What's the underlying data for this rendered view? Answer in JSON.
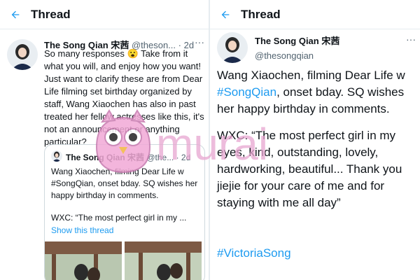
{
  "colors": {
    "accent": "#1d9bf0",
    "text": "#0f1419",
    "muted": "#536471",
    "border": "#cfd9de"
  },
  "left": {
    "header": {
      "title": "Thread",
      "back_icon": "arrow-left-icon"
    },
    "tweet": {
      "name": "The Song Qian 宋茜",
      "handle": "@theson...",
      "time": "· 2d",
      "text": "So many responses 😮 Take from it what you will, and enjoy how you want! Just want to clarify these are from Dear Life filming set birthday organized by staff, Wang Xiaochen has also in past treated her fellow actresses like this, it's not an announcement or anything particular?"
    },
    "quote": {
      "name": "The Song Qian 宋茜",
      "handle": "@the...",
      "time": "· 2d",
      "text": "Wang Xiaochen, filming Dear Life w #SongQian, onset bday. SQ wishes her happy birthday in comments.",
      "wxc": "WXC: “The most perfect girl in my ...",
      "show_thread": "Show this thread"
    }
  },
  "right": {
    "header": {
      "title": "Thread",
      "back_icon": "arrow-left-icon"
    },
    "tweet": {
      "name": "The Song Qian 宋茜",
      "handle": "@thesongqian",
      "text_before_link": "Wang Xiaochen, filming Dear Life w ",
      "link": "#SongQian",
      "text_after_link": ", onset bday. SQ wishes her happy birthday in comments.",
      "quote_text": "WXC: “The most perfect girl in my eyes, kind, outstanding, lovely, hardworking, beautiful... Thank you jiejie for your care of me and for staying with me all day”",
      "hashtag": "#VictoriaSong"
    }
  },
  "watermark": {
    "text": "murai"
  }
}
